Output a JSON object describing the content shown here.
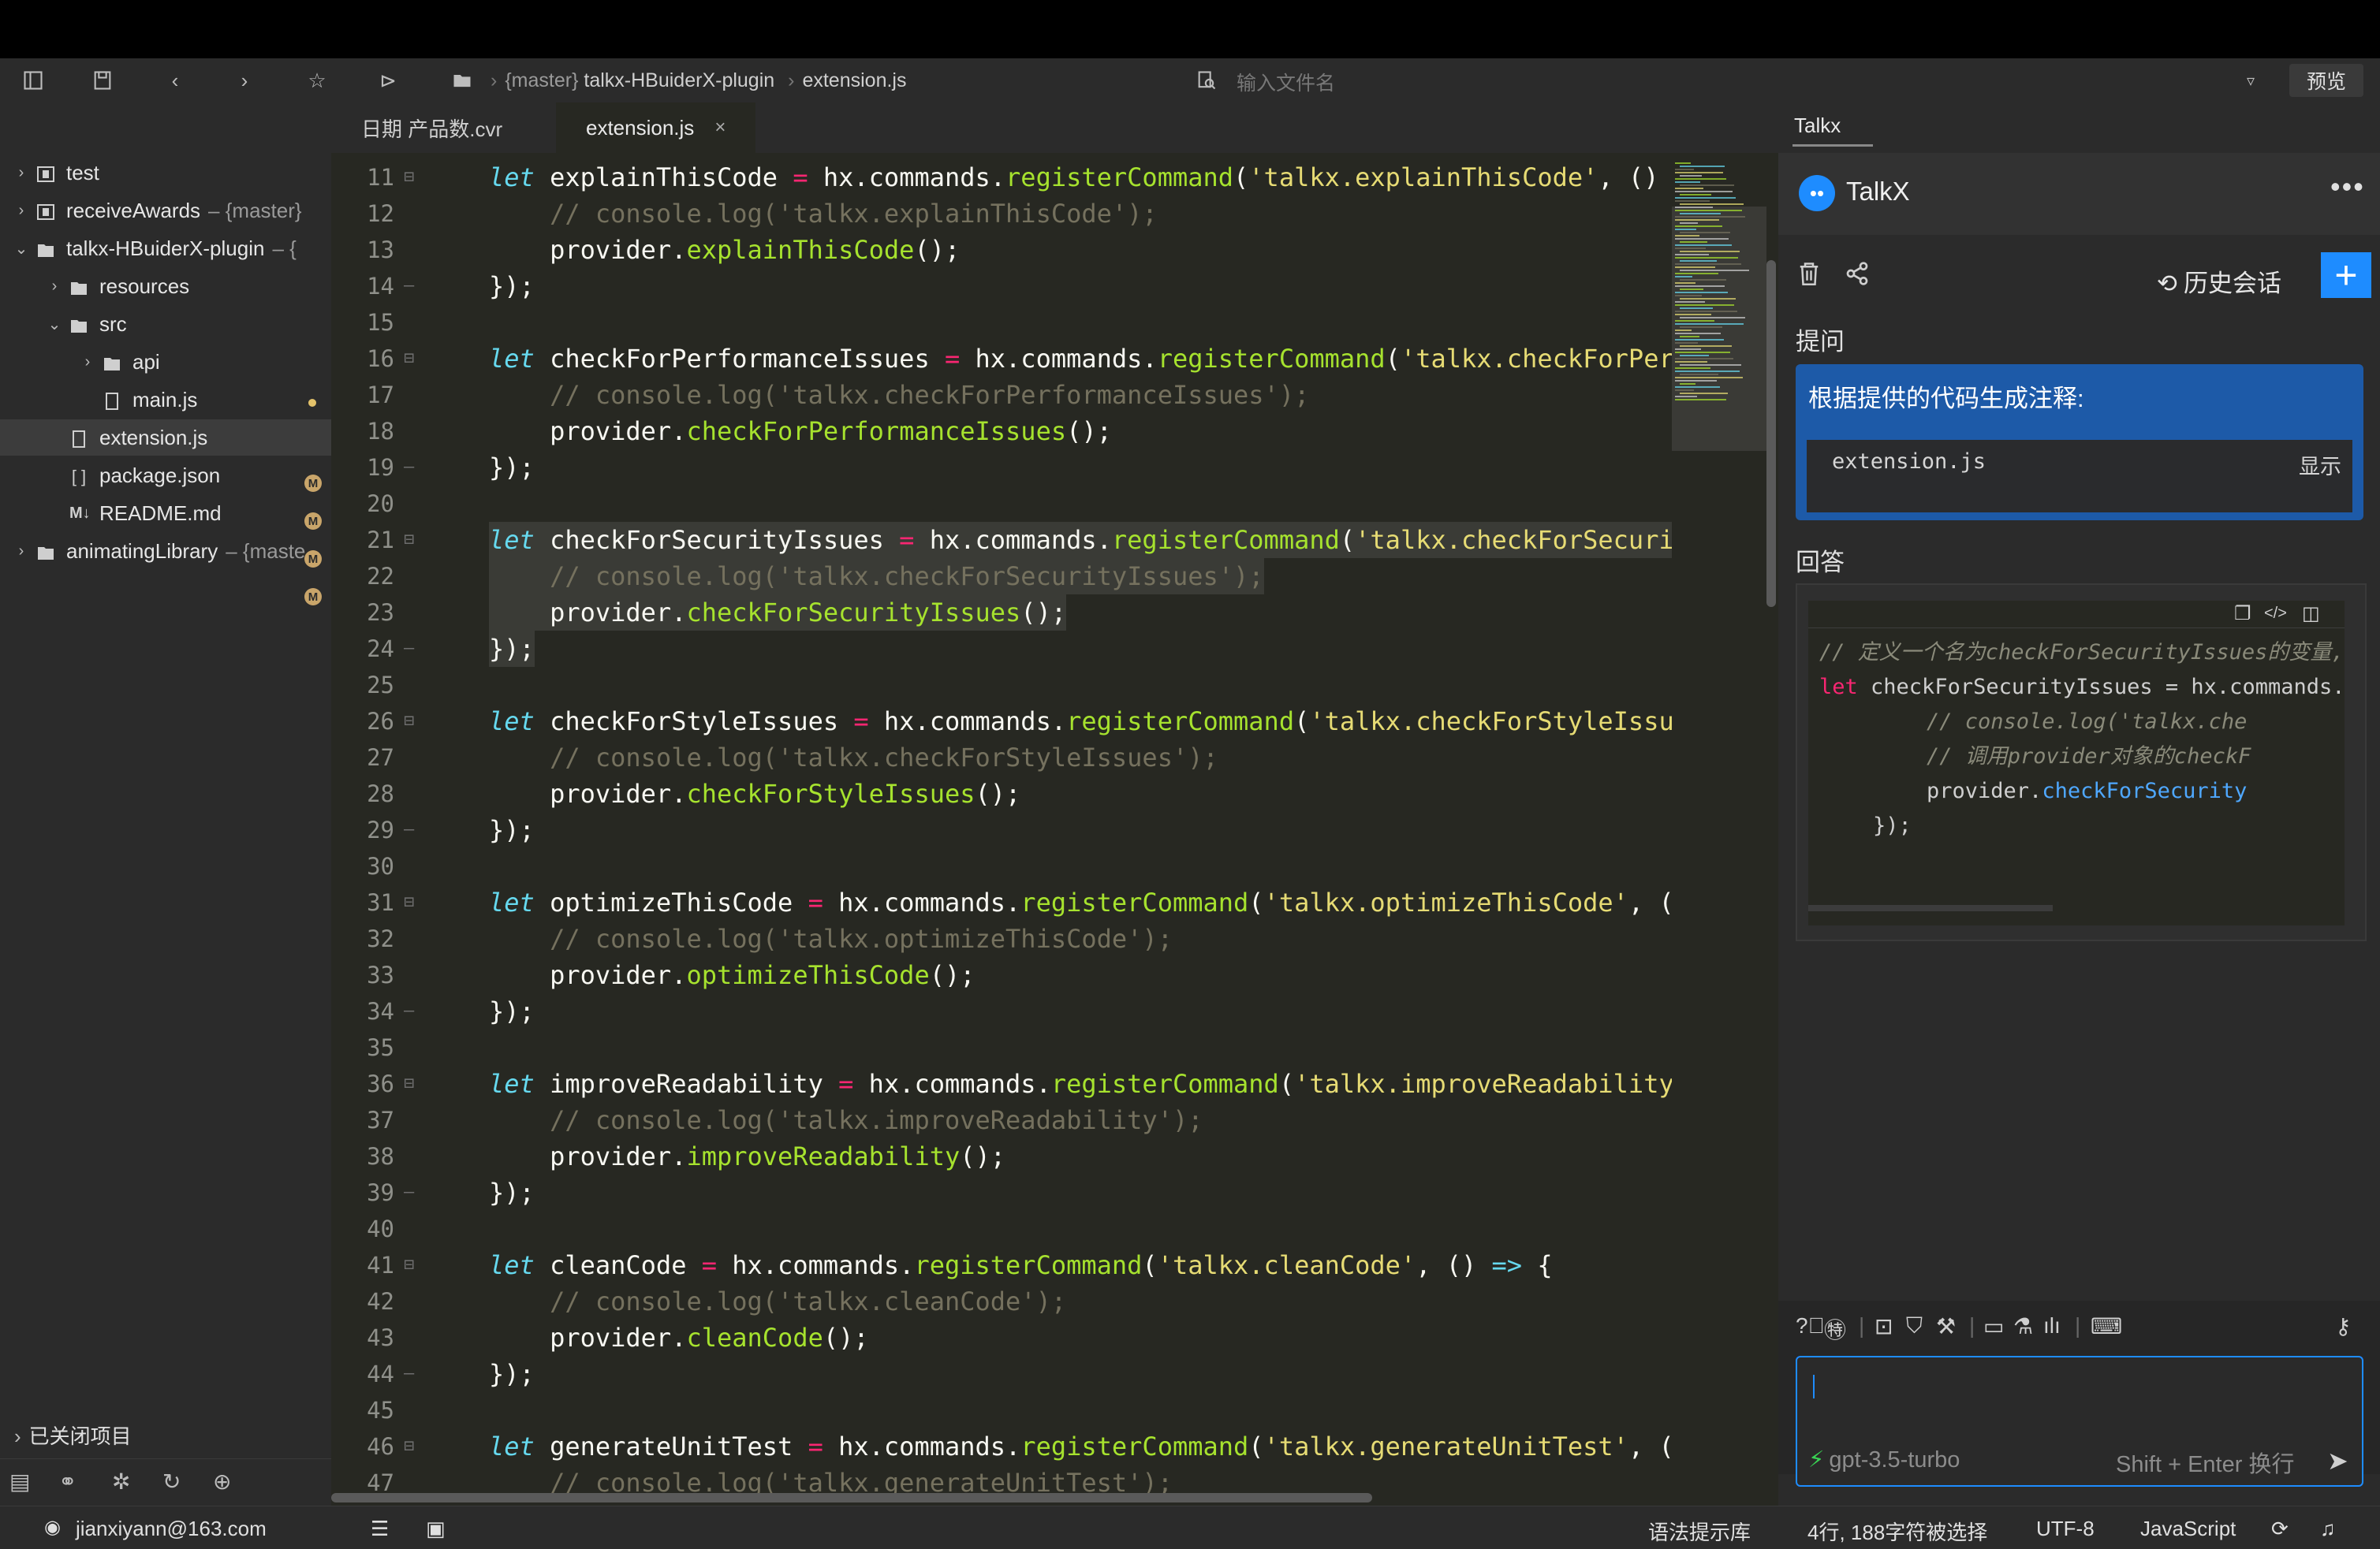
{
  "toolbar": {
    "breadcrumb_branch": "{master}",
    "breadcrumb_project": "talkx-HBuiderX-plugin",
    "breadcrumb_file": "extension.js",
    "file_search_placeholder": "输入文件名",
    "preview_label": "预览"
  },
  "sidebar": {
    "items": [
      {
        "label": "test",
        "suffix": ""
      },
      {
        "label": "receiveAwards",
        "suffix": "– {master}"
      },
      {
        "label": "talkx-HBuiderX-plugin",
        "suffix": "– {"
      },
      {
        "label": "resources",
        "suffix": ""
      },
      {
        "label": "src",
        "suffix": ""
      },
      {
        "label": "api",
        "suffix": ""
      },
      {
        "label": "main.js",
        "suffix": "",
        "badge": "M"
      },
      {
        "label": "extension.js",
        "suffix": "",
        "badge": "M"
      },
      {
        "label": "package.json",
        "suffix": "",
        "badge": "M"
      },
      {
        "label": "README.md",
        "suffix": "",
        "badge": "M"
      },
      {
        "label": "animatingLibrary",
        "suffix": "– {maste"
      }
    ],
    "closed_projects": "已关闭项目"
  },
  "tabs": [
    {
      "label": "日期 产品数.cvr"
    },
    {
      "label": "extension.js",
      "close": "×"
    }
  ],
  "code_lines": [
    {
      "n": "11",
      "fold": "⊟",
      "tokens": [
        [
          "kw",
          "let"
        ],
        [
          "t",
          " explainThisCode "
        ],
        [
          "op",
          "="
        ],
        [
          "t",
          " hx.commands."
        ],
        [
          "fn",
          "registerCommand"
        ],
        [
          "t",
          "("
        ],
        [
          "str",
          "'talkx.explainThisCode'"
        ],
        [
          "t",
          ", ()"
        ]
      ]
    },
    {
      "n": "12",
      "fold": "",
      "tokens": [
        [
          "t",
          "    "
        ],
        [
          "cm",
          "// console.log('talkx.explainThisCode');"
        ]
      ]
    },
    {
      "n": "13",
      "fold": "",
      "tokens": [
        [
          "t",
          "    provider."
        ],
        [
          "fn",
          "explainThisCode"
        ],
        [
          "t",
          "();"
        ]
      ]
    },
    {
      "n": "14",
      "fold": "–",
      "tokens": [
        [
          "t",
          "});"
        ]
      ]
    },
    {
      "n": "15",
      "fold": "",
      "tokens": []
    },
    {
      "n": "16",
      "fold": "⊟",
      "tokens": [
        [
          "kw",
          "let"
        ],
        [
          "t",
          " checkForPerformanceIssues "
        ],
        [
          "op",
          "="
        ],
        [
          "t",
          " hx.commands."
        ],
        [
          "fn",
          "registerCommand"
        ],
        [
          "t",
          "("
        ],
        [
          "str",
          "'talkx.checkForPer"
        ]
      ]
    },
    {
      "n": "17",
      "fold": "",
      "tokens": [
        [
          "t",
          "    "
        ],
        [
          "cm",
          "// console.log('talkx.checkForPerformanceIssues');"
        ]
      ]
    },
    {
      "n": "18",
      "fold": "",
      "tokens": [
        [
          "t",
          "    provider."
        ],
        [
          "fn",
          "checkForPerformanceIssues"
        ],
        [
          "t",
          "();"
        ]
      ]
    },
    {
      "n": "19",
      "fold": "–",
      "tokens": [
        [
          "t",
          "});"
        ]
      ]
    },
    {
      "n": "20",
      "fold": "",
      "tokens": []
    },
    {
      "n": "21",
      "fold": "⊟",
      "hl": true,
      "tokens": [
        [
          "kw",
          "let"
        ],
        [
          "t",
          " checkForSecurityIssues "
        ],
        [
          "op",
          "="
        ],
        [
          "t",
          " hx.commands."
        ],
        [
          "fn",
          "registerCommand"
        ],
        [
          "t",
          "("
        ],
        [
          "str",
          "'talkx.checkForSecuri"
        ]
      ]
    },
    {
      "n": "22",
      "fold": "",
      "hl": true,
      "tokens": [
        [
          "t",
          "    "
        ],
        [
          "cm",
          "// console.log('talkx.checkForSecurityIssues');"
        ]
      ]
    },
    {
      "n": "23",
      "fold": "",
      "hl": true,
      "tokens": [
        [
          "t",
          "    provider."
        ],
        [
          "fn",
          "checkForSecurityIssues"
        ],
        [
          "t",
          "();"
        ]
      ]
    },
    {
      "n": "24",
      "fold": "–",
      "hl": true,
      "tokens": [
        [
          "t",
          "});"
        ]
      ]
    },
    {
      "n": "25",
      "fold": "",
      "tokens": []
    },
    {
      "n": "26",
      "fold": "⊟",
      "tokens": [
        [
          "kw",
          "let"
        ],
        [
          "t",
          " checkForStyleIssues "
        ],
        [
          "op",
          "="
        ],
        [
          "t",
          " hx.commands."
        ],
        [
          "fn",
          "registerCommand"
        ],
        [
          "t",
          "("
        ],
        [
          "str",
          "'talkx.checkForStyleIssu"
        ]
      ]
    },
    {
      "n": "27",
      "fold": "",
      "tokens": [
        [
          "t",
          "    "
        ],
        [
          "cm",
          "// console.log('talkx.checkForStyleIssues');"
        ]
      ]
    },
    {
      "n": "28",
      "fold": "",
      "tokens": [
        [
          "t",
          "    provider."
        ],
        [
          "fn",
          "checkForStyleIssues"
        ],
        [
          "t",
          "();"
        ]
      ]
    },
    {
      "n": "29",
      "fold": "–",
      "tokens": [
        [
          "t",
          "});"
        ]
      ]
    },
    {
      "n": "30",
      "fold": "",
      "tokens": []
    },
    {
      "n": "31",
      "fold": "⊟",
      "tokens": [
        [
          "kw",
          "let"
        ],
        [
          "t",
          " optimizeThisCode "
        ],
        [
          "op",
          "="
        ],
        [
          "t",
          " hx.commands."
        ],
        [
          "fn",
          "registerCommand"
        ],
        [
          "t",
          "("
        ],
        [
          "str",
          "'talkx.optimizeThisCode'"
        ],
        [
          "t",
          ", ("
        ]
      ]
    },
    {
      "n": "32",
      "fold": "",
      "tokens": [
        [
          "t",
          "    "
        ],
        [
          "cm",
          "// console.log('talkx.optimizeThisCode');"
        ]
      ]
    },
    {
      "n": "33",
      "fold": "",
      "tokens": [
        [
          "t",
          "    provider."
        ],
        [
          "fn",
          "optimizeThisCode"
        ],
        [
          "t",
          "();"
        ]
      ]
    },
    {
      "n": "34",
      "fold": "–",
      "tokens": [
        [
          "t",
          "});"
        ]
      ]
    },
    {
      "n": "35",
      "fold": "",
      "tokens": []
    },
    {
      "n": "36",
      "fold": "⊟",
      "tokens": [
        [
          "kw",
          "let"
        ],
        [
          "t",
          " improveReadability "
        ],
        [
          "op",
          "="
        ],
        [
          "t",
          " hx.commands."
        ],
        [
          "fn",
          "registerCommand"
        ],
        [
          "t",
          "("
        ],
        [
          "str",
          "'talkx.improveReadability"
        ]
      ]
    },
    {
      "n": "37",
      "fold": "",
      "tokens": [
        [
          "t",
          "    "
        ],
        [
          "cm",
          "// console.log('talkx.improveReadability');"
        ]
      ]
    },
    {
      "n": "38",
      "fold": "",
      "tokens": [
        [
          "t",
          "    provider."
        ],
        [
          "fn",
          "improveReadability"
        ],
        [
          "t",
          "();"
        ]
      ]
    },
    {
      "n": "39",
      "fold": "–",
      "tokens": [
        [
          "t",
          "});"
        ]
      ]
    },
    {
      "n": "40",
      "fold": "",
      "tokens": []
    },
    {
      "n": "41",
      "fold": "⊟",
      "tokens": [
        [
          "kw",
          "let"
        ],
        [
          "t",
          " cleanCode "
        ],
        [
          "op",
          "="
        ],
        [
          "t",
          " hx.commands."
        ],
        [
          "fn",
          "registerCommand"
        ],
        [
          "t",
          "("
        ],
        [
          "str",
          "'talkx.cleanCode'"
        ],
        [
          "t",
          ", () "
        ],
        [
          "kw",
          "=>"
        ],
        [
          "t",
          " {"
        ]
      ]
    },
    {
      "n": "42",
      "fold": "",
      "tokens": [
        [
          "t",
          "    "
        ],
        [
          "cm",
          "// console.log('talkx.cleanCode');"
        ]
      ]
    },
    {
      "n": "43",
      "fold": "",
      "tokens": [
        [
          "t",
          "    provider."
        ],
        [
          "fn",
          "cleanCode"
        ],
        [
          "t",
          "();"
        ]
      ]
    },
    {
      "n": "44",
      "fold": "–",
      "tokens": [
        [
          "t",
          "});"
        ]
      ]
    },
    {
      "n": "45",
      "fold": "",
      "tokens": []
    },
    {
      "n": "46",
      "fold": "⊟",
      "tokens": [
        [
          "kw",
          "let"
        ],
        [
          "t",
          " generateUnitTest "
        ],
        [
          "op",
          "="
        ],
        [
          "t",
          " hx.commands."
        ],
        [
          "fn",
          "registerCommand"
        ],
        [
          "t",
          "("
        ],
        [
          "str",
          "'talkx.generateUnitTest'"
        ],
        [
          "t",
          ", ("
        ]
      ]
    },
    {
      "n": "47",
      "fold": "",
      "tokens": [
        [
          "t",
          "    "
        ],
        [
          "cm",
          "// console.log('talkx.generateUnitTest');"
        ]
      ]
    }
  ],
  "panel": {
    "tab_label": "Talkx",
    "title": "TalkX",
    "more": "•••",
    "history_label": "历史会话",
    "question_label": "提问",
    "question_text": "根据提供的代码生成注释:",
    "question_file": "extension.js",
    "question_show": "显示",
    "answer_label": "回答",
    "answer_lines": [
      {
        "indent": 0,
        "tokens": [
          [
            "cm",
            "// 定义一个名为checkForSecurityIssues的变量,"
          ]
        ]
      },
      {
        "indent": 0,
        "tokens": [
          [
            "op",
            "let"
          ],
          [
            "t",
            " checkForSecurityIssues = hx.commands."
          ]
        ]
      },
      {
        "indent": 1,
        "tokens": [
          [
            "cm",
            "// console.log('talkx.che"
          ]
        ]
      },
      {
        "indent": 1,
        "tokens": [
          [
            "cm",
            "// 调用provider对象的checkF"
          ]
        ]
      },
      {
        "indent": 1,
        "tokens": [
          [
            "t",
            "provider."
          ],
          [
            "link",
            "checkForSecurity"
          ]
        ]
      },
      {
        "indent": 2,
        "tokens": [
          [
            "t",
            "});"
          ]
        ]
      }
    ],
    "model": "gpt-3.5-turbo",
    "newline_hint": "Shift + Enter 换行"
  },
  "status": {
    "user": "jianxiyann@163.com",
    "syntax_lib": "语法提示库",
    "selection": "4行, 188字符被选择",
    "encoding": "UTF-8",
    "language": "JavaScript"
  },
  "colors": {
    "editor_bg": "#272822",
    "keyword": "#66d9ef",
    "function": "#a6e22e",
    "string": "#e6db74",
    "comment": "#75715e",
    "operator": "#f92672",
    "accent_blue": "#1e8cff"
  }
}
